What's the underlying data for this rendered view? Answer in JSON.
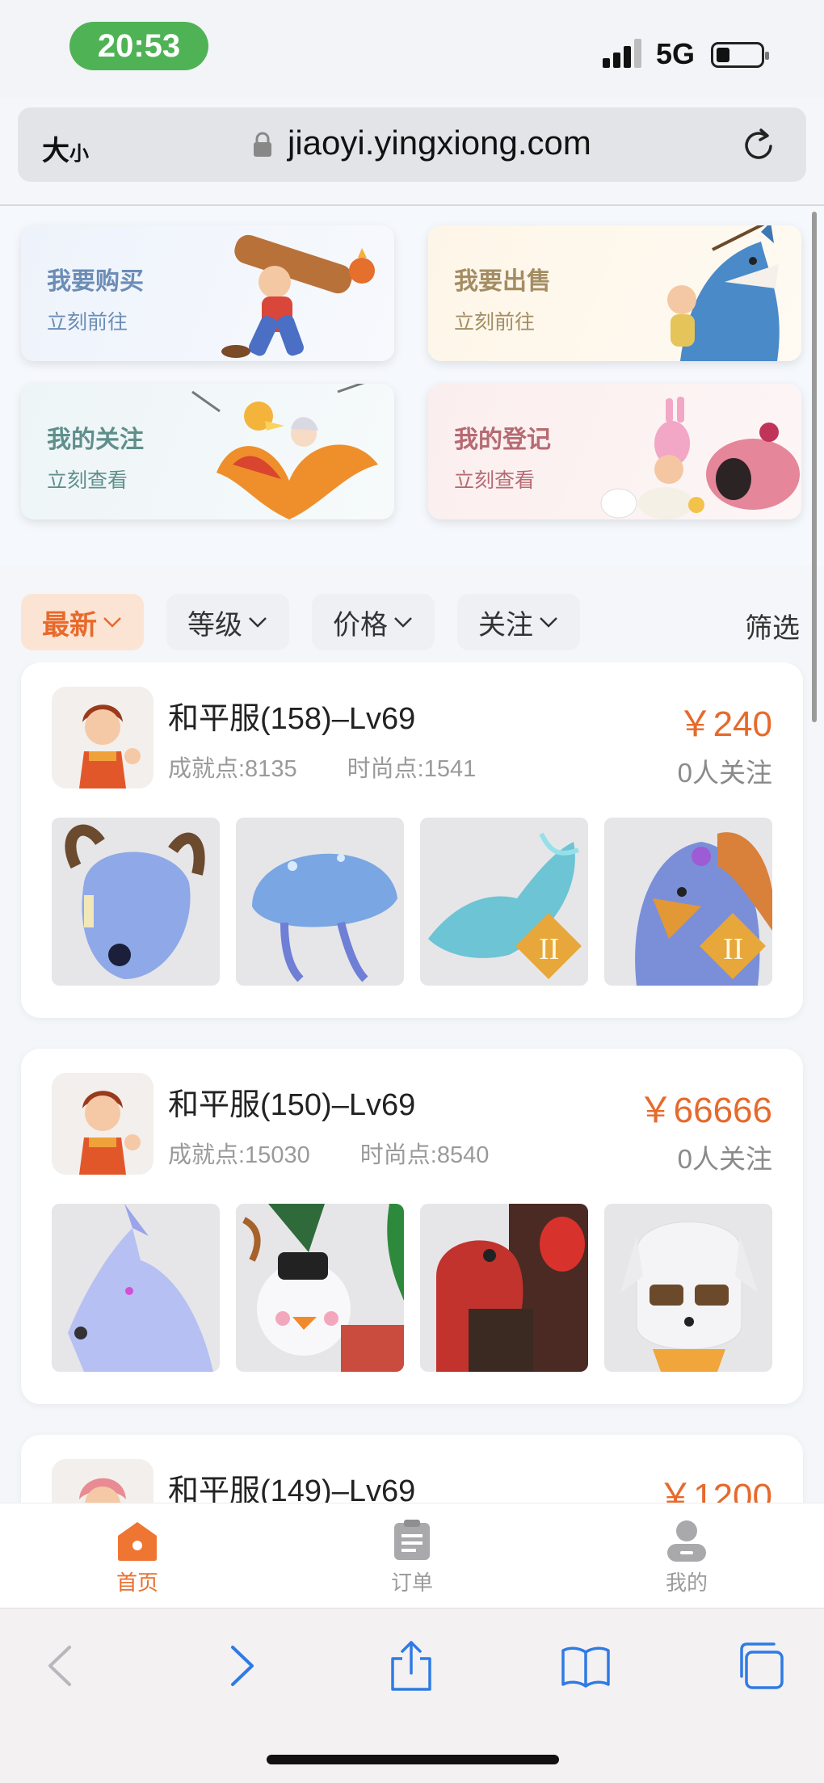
{
  "status_bar": {
    "time": "20:53",
    "network": "5G"
  },
  "address_bar": {
    "text_size_label": "大",
    "text_size_small": "小",
    "url": "jiaoyi.yingxiong.com"
  },
  "entries": [
    {
      "title": "我要购买",
      "sub": "立刻前往"
    },
    {
      "title": "我要出售",
      "sub": "立刻前往"
    },
    {
      "title": "我的关注",
      "sub": "立刻查看"
    },
    {
      "title": "我的登记",
      "sub": "立刻查看"
    }
  ],
  "filters": {
    "tabs": [
      {
        "label": "最新",
        "active": true
      },
      {
        "label": "等级",
        "active": false
      },
      {
        "label": "价格",
        "active": false
      },
      {
        "label": "关注",
        "active": false
      }
    ],
    "screen_label": "筛选"
  },
  "listings": [
    {
      "server": "和平服(158)–Lv69",
      "achievement": "成就点:8135",
      "fashion": "时尚点:1541",
      "price": "￥240",
      "follows": "0人关注"
    },
    {
      "server": "和平服(150)–Lv69",
      "achievement": "成就点:15030",
      "fashion": "时尚点:8540",
      "price": "￥66666",
      "follows": "0人关注"
    },
    {
      "server": "和平服(149)–Lv69",
      "achievement": "",
      "fashion": "",
      "price": "￥1200",
      "follows": ""
    }
  ],
  "tab_bar": [
    {
      "label": "首页",
      "icon": "home-icon",
      "active": true
    },
    {
      "label": "订单",
      "icon": "clipboard-icon",
      "active": false
    },
    {
      "label": "我的",
      "icon": "user-icon",
      "active": false
    }
  ],
  "colors": {
    "accent": "#e8692a",
    "price": "#e66a2c",
    "status_pill": "#4fb356"
  }
}
